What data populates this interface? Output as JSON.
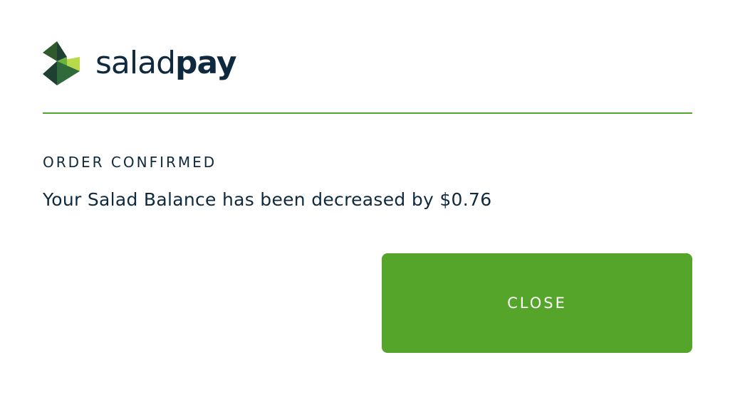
{
  "brand": {
    "icon": "saladpay-logo-icon",
    "wordmark_light": "salad",
    "wordmark_bold": "pay",
    "colors": {
      "text": "#0f2a3e",
      "leaf_dark": "#2f5a2c",
      "leaf_mid": "#1f4a3a",
      "leaf_light": "#b8d94a",
      "leaf_green": "#6bb33a"
    }
  },
  "dialog": {
    "heading": "ORDER CONFIRMED",
    "message": "Your Salad Balance has been decreased by $0.76",
    "close_label": "CLOSE"
  },
  "theme": {
    "accent": "#55a52a",
    "divider": "#53a62c",
    "background": "#ffffff"
  }
}
